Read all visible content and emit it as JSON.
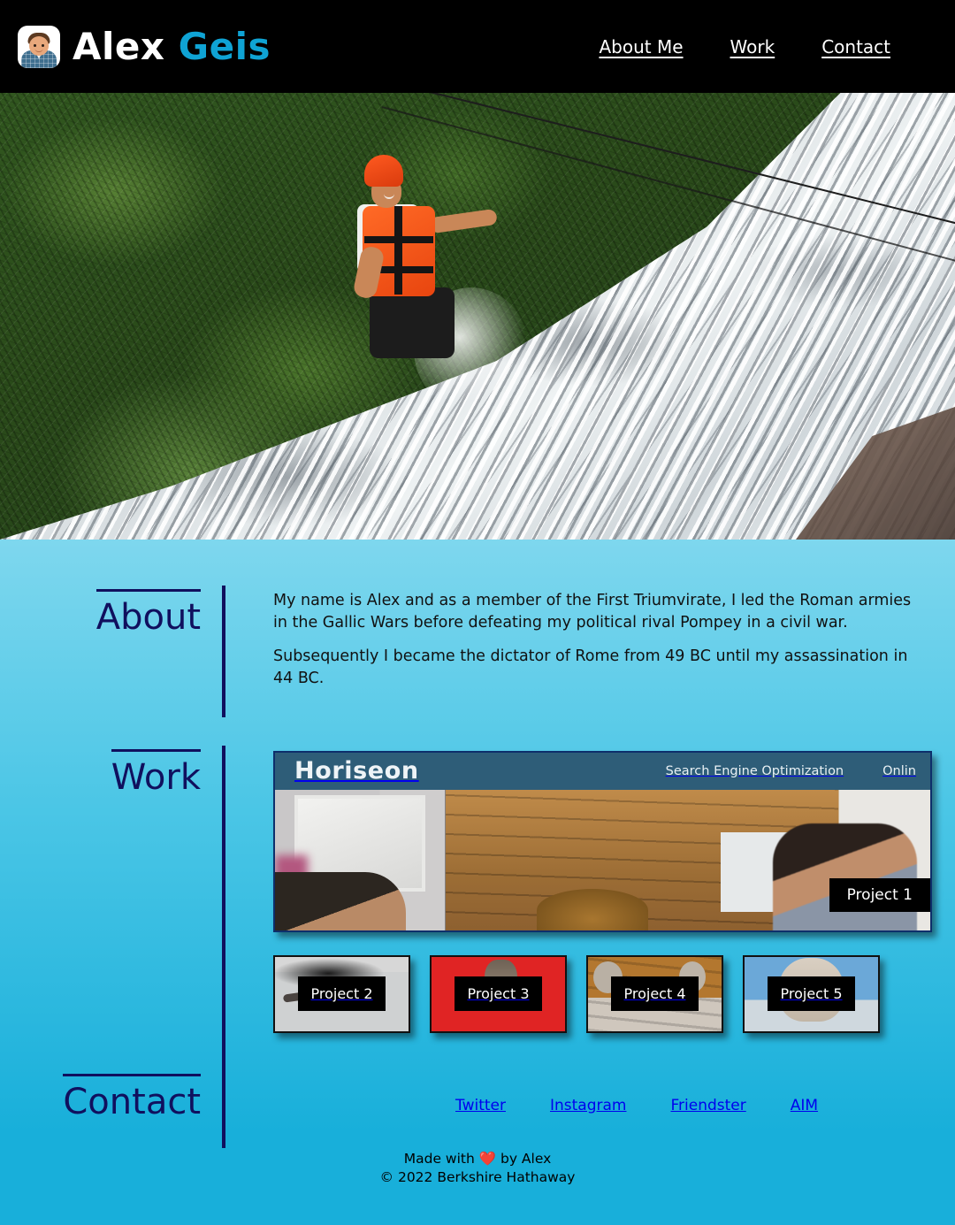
{
  "header": {
    "logo_icon": "avatar-icon",
    "brand_first": "Alex",
    "brand_last": "Geis",
    "nav": [
      {
        "label": "About Me"
      },
      {
        "label": "Work"
      },
      {
        "label": "Contact"
      }
    ]
  },
  "hero": {
    "alt": "man-rappelling-down-waterfall-photo"
  },
  "about": {
    "title": "About",
    "paragraphs": [
      "My name is Alex and as a member of the First Triumvirate, I led the Roman armies in the Gallic Wars before defeating my political rival Pompey in a civil war.",
      "Subsequently I became the dictator of Rome from 49 BC until my assassination in 44 BC."
    ]
  },
  "work": {
    "title": "Work",
    "featured": {
      "label": "Project 1",
      "site_logo": "Horiseon",
      "site_nav": [
        "Search Engine Optimization",
        "Onlin"
      ]
    },
    "projects": [
      {
        "label": "Project 2",
        "art": "cat2"
      },
      {
        "label": "Project 3",
        "art": "cat3"
      },
      {
        "label": "Project 4",
        "art": "cat4"
      },
      {
        "label": "Project 5",
        "art": "cat5"
      }
    ]
  },
  "contact": {
    "title": "Contact",
    "links": [
      {
        "label": "Twitter"
      },
      {
        "label": "Instagram"
      },
      {
        "label": "Friendster"
      },
      {
        "label": "AIM"
      }
    ]
  },
  "footer": {
    "line1_prefix": "Made with ",
    "heart_icon": "❤️",
    "line1_suffix": " by Alex",
    "line2": "© 2022 Berkshire Hathaway"
  },
  "colors": {
    "header_bg": "#000000",
    "brand_accent": "#0FA3D4",
    "section_heading": "#10105E",
    "page_bg_top": "#7ED7EE",
    "page_bg_bottom": "#18AFDA",
    "link_blue": "#0000EE",
    "card_border": "#0D2F6B",
    "label_bg": "#000000"
  }
}
